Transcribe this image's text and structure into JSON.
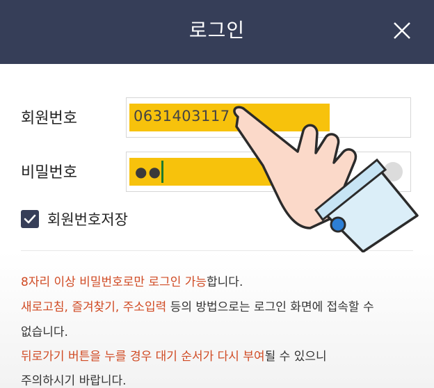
{
  "dialog": {
    "title": "로그인",
    "close_icon": "close-icon"
  },
  "form": {
    "member_label": "회원번호",
    "member_value": "0631403117",
    "password_label": "비밀번호",
    "password_value": "●●",
    "save_label": "회원번호저장",
    "save_checked": true
  },
  "notice": {
    "line1_red": "8자리 이상 비밀번호로만 로그인 가능",
    "line1_rest": "합니다.",
    "line2_red": "새로고침, 즐겨찾기, 주소입력",
    "line2_rest": " 등의 방법으로는 로그인 화면에 접속할 수",
    "line3": "없습니다.",
    "line4_red": "뒤로가기 버튼을 누를 경우 대기 순서가 다시 부여",
    "line4_rest": "될 수 있으니",
    "line5": "주의하시기 바랍니다."
  },
  "colors": {
    "header": "#363e58",
    "highlight": "#f7c20c",
    "accent_red": "#d04a23"
  }
}
